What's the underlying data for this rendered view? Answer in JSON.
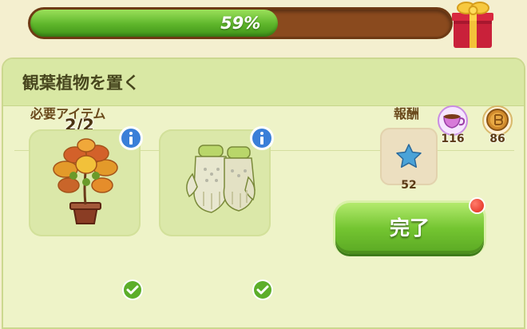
{
  "progress": {
    "value": 0.59,
    "label": "59%"
  },
  "panel": {
    "title": "観葉植物を置く"
  },
  "resources": [
    {
      "icon": "teacup-icon",
      "count": "116"
    },
    {
      "icon": "coin-icon",
      "count": "86"
    }
  ],
  "required": {
    "label": "必要アイテム",
    "count": "2/2",
    "items": [
      {
        "icon": "potted-plant-icon",
        "checked": true
      },
      {
        "icon": "garden-gloves-icon",
        "checked": true
      }
    ]
  },
  "reward": {
    "label": "報酬",
    "icon": "blue-star-icon",
    "count": "52"
  },
  "complete": {
    "label": "完了"
  },
  "colors": {
    "progress_fill": "#5db52a",
    "progress_track": "#8a4a1e",
    "button": "#74c531",
    "notification": "#e0271c"
  }
}
